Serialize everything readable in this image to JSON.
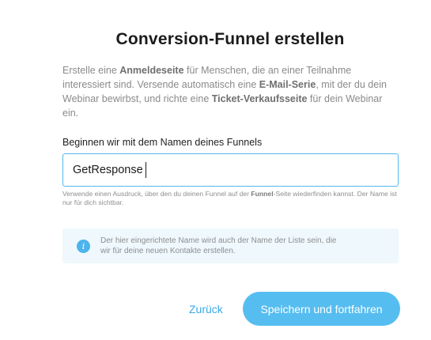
{
  "dialog": {
    "title": "Conversion-Funnel erstellen",
    "intro": {
      "p1": "Erstelle eine ",
      "b1": "Anmeldeseite",
      "p2": " für Menschen, die an einer Teilnahme interessiert sind. Versende automatisch eine ",
      "b2": "E-Mail-Serie",
      "p3": ", mit der du dein Webinar bewirbst, und richte eine ",
      "b3": "Ticket-Verkaufsseite",
      "p4": " für dein Webinar ein."
    },
    "name_field": {
      "label": "Beginnen wir mit dem Namen deines Funnels",
      "value": "GetResponse",
      "help": {
        "p1": "Verwende einen Ausdruck, über den du deinen Funnel auf der ",
        "b1": "Funnel",
        "p2": "-Seite wiederfinden kannst. Der Name ist nur für dich sichtbar."
      }
    },
    "info": {
      "icon": "info-icon",
      "text": "Der hier eingerichtete Name wird auch der Name der Liste sein, die wir für deine neuen Kontakte erstellen."
    },
    "actions": {
      "back_label": "Zurück",
      "save_label": "Speichern und fortfahren"
    },
    "colors": {
      "accent": "#56bdf0",
      "link": "#3aa8e6",
      "input_border": "#52b8ec",
      "info_bg": "#eef8fd"
    }
  }
}
